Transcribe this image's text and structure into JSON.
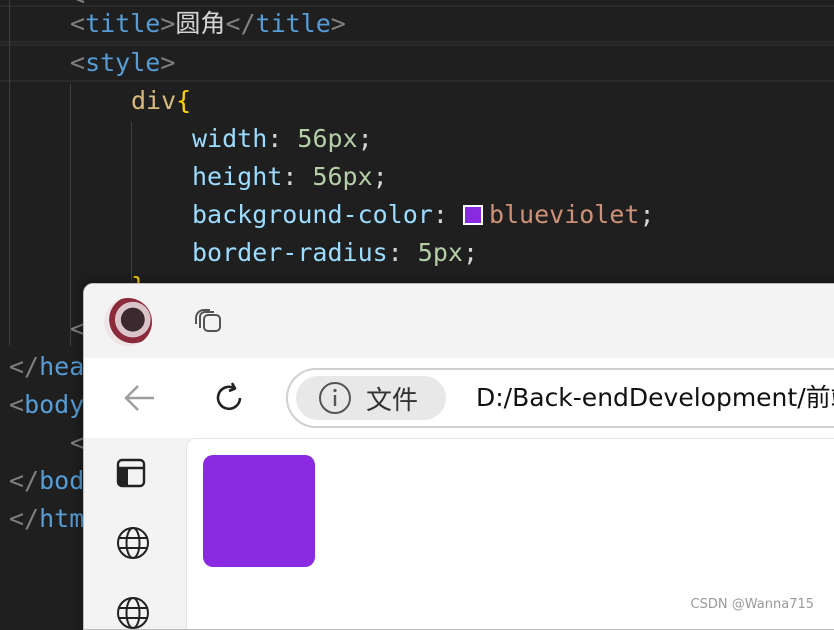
{
  "code": {
    "title_tag_open": "<title>",
    "title_tag_lt": "<",
    "title_tag_name": "title",
    "title_tag_gt": ">",
    "title_text": "圆角",
    "title_close_lt": "</",
    "title_close_name": "title",
    "title_close_gt": ">",
    "style_lt": "<",
    "style_name": "style",
    "style_gt": ">",
    "selector": "div",
    "brace_open": "{",
    "brace_close": "}",
    "decls": [
      {
        "prop": "width",
        "value": "56px",
        "kind": "num"
      },
      {
        "prop": "height",
        "value": "56px",
        "kind": "num"
      },
      {
        "prop": "background-color",
        "value": "blueviolet",
        "kind": "color"
      },
      {
        "prop": "border-radius",
        "value": "5px",
        "kind": "num"
      }
    ],
    "colon": ":",
    "semicolon": ";",
    "swatch_color": "#8a2be2",
    "partial_lines": [
      {
        "lt": "<",
        "name": ""
      },
      {
        "lt": "</",
        "name": "hea"
      },
      {
        "lt": "<",
        "name": "body"
      },
      {
        "lt": "<",
        "name": ""
      },
      {
        "lt": "</",
        "name": "bod"
      },
      {
        "lt": "</",
        "name": "htm"
      }
    ]
  },
  "browser": {
    "avatar_icon": "avatar",
    "tabs_icon": "tab-actions-icon",
    "back_icon": "back-arrow-icon",
    "refresh_icon": "refresh-icon",
    "info_icon": "info-icon",
    "chip_label": "文件",
    "url": "D:/Back-endDevelopment/前端",
    "sidebar_icons": [
      "sidebar-panel-icon",
      "globe-icon",
      "globe-icon"
    ],
    "box_color": "#8a2be2"
  },
  "watermark": "CSDN @Wanna715"
}
